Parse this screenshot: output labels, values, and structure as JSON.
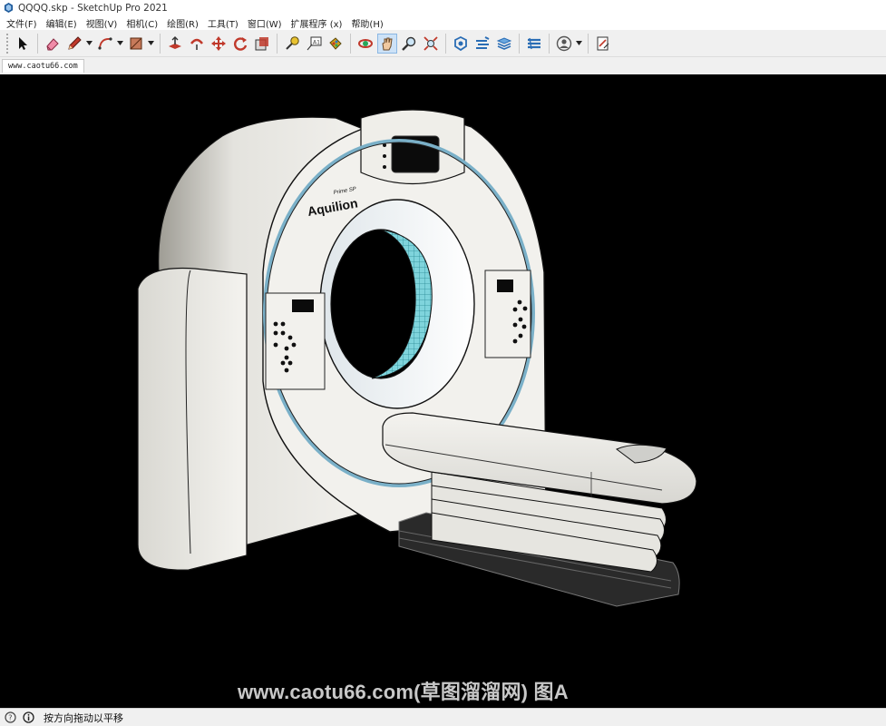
{
  "window": {
    "title": "QQQQ.skp - SketchUp Pro 2021",
    "app_icon": "sketchup-app-icon"
  },
  "menu": [
    {
      "label": "文件(F)"
    },
    {
      "label": "编辑(E)"
    },
    {
      "label": "视图(V)"
    },
    {
      "label": "相机(C)"
    },
    {
      "label": "绘图(R)"
    },
    {
      "label": "工具(T)"
    },
    {
      "label": "窗口(W)"
    },
    {
      "label": "扩展程序 (x)"
    },
    {
      "label": "帮助(H)"
    }
  ],
  "toolbar": {
    "tools": [
      "select-icon",
      "eraser-icon",
      "pencil-line-icon",
      "arc-icon",
      "rectangle-icon",
      "push-pull-icon",
      "follow-me-icon",
      "move-icon",
      "rotate-icon",
      "scale-icon",
      "tape-measure-icon",
      "text-icon",
      "paint-bucket-icon",
      "orbit-icon",
      "pan-icon",
      "zoom-icon",
      "zoom-extents-icon",
      "warehouse-icon",
      "components-icon",
      "layers-icon",
      "extension-warehouse-icon",
      "account-icon",
      "layout-icon"
    ],
    "active_tool": "pan-icon"
  },
  "scene_tab": {
    "label": "www.caotu66.com"
  },
  "viewport": {
    "background": "#000000",
    "model_brand_text": "Aquilion",
    "model_sub_text": "Prime SP",
    "watermark": "www.caotu66.com(草图溜溜网) 图A"
  },
  "status": {
    "message": "按方向拖动以平移",
    "icons": [
      "geo-location-icon",
      "info-icon"
    ]
  }
}
